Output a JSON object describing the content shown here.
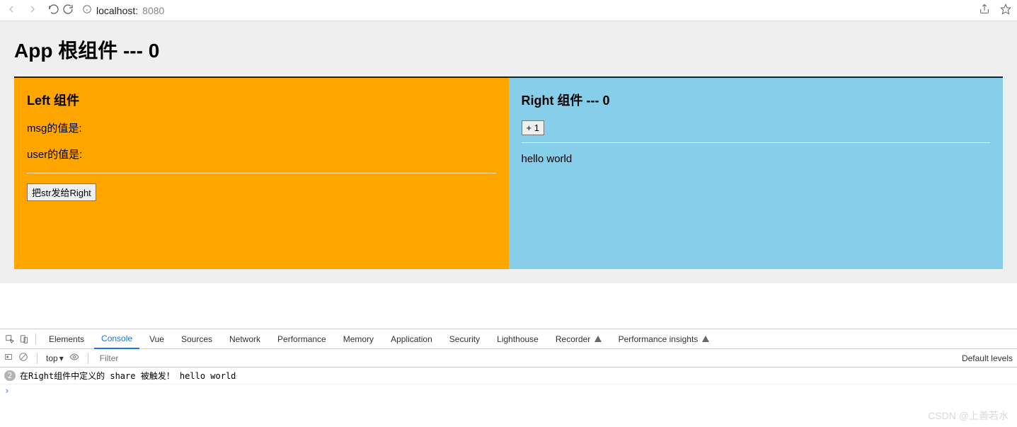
{
  "browser": {
    "host": "localhost:",
    "port": "8080"
  },
  "app": {
    "title": "App 根组件 --- 0"
  },
  "left": {
    "title": "Left 组件",
    "msg_line": "msg的值是:",
    "user_line": "user的值是:",
    "button": "把str发给Right"
  },
  "right": {
    "title": "Right 组件 --- 0",
    "button": "+ 1",
    "text": "hello world"
  },
  "devtools": {
    "tabs": {
      "elements": "Elements",
      "console": "Console",
      "vue": "Vue",
      "sources": "Sources",
      "network": "Network",
      "performance": "Performance",
      "memory": "Memory",
      "application": "Application",
      "security": "Security",
      "lighthouse": "Lighthouse",
      "recorder": "Recorder",
      "insights": "Performance insights"
    },
    "toolbar": {
      "context": "top",
      "filter_placeholder": "Filter",
      "default_levels": "Default levels"
    },
    "log": {
      "count": "2",
      "text": "在Right组件中定义的 share 被触发！  hello world"
    }
  },
  "watermark": "CSDN @上善若水"
}
